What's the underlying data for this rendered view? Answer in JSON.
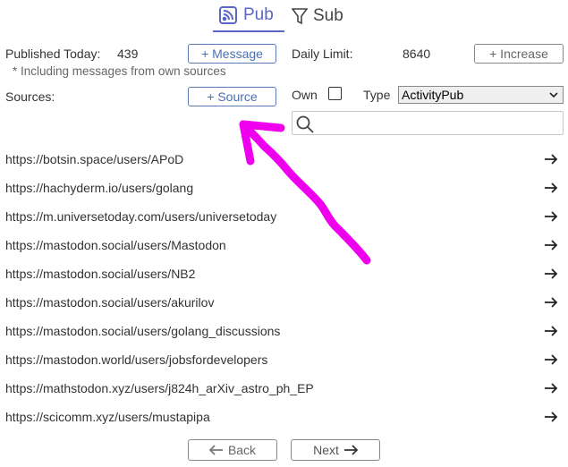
{
  "tabs": [
    {
      "label": "Pub",
      "icon": "rss-icon",
      "active": true
    },
    {
      "label": "Sub",
      "icon": "filter-icon",
      "active": false
    }
  ],
  "stats": {
    "published_label": "Published Today:",
    "published_value": "439",
    "message_button": "+ Message",
    "limit_label": "Daily Limit:",
    "limit_value": "8640",
    "increase_button": "+ Increase",
    "note": "* Including messages from own sources"
  },
  "sources": {
    "label": "Sources:",
    "add_button": "+ Source",
    "own_label": "Own",
    "own_checked": false,
    "type_label": "Type",
    "type_value": "ActivityPub",
    "search_value": ""
  },
  "items": [
    {
      "url": "https://botsin.space/users/APoD"
    },
    {
      "url": "https://hachyderm.io/users/golang"
    },
    {
      "url": "https://m.universetoday.com/users/universetoday"
    },
    {
      "url": "https://mastodon.social/users/Mastodon"
    },
    {
      "url": "https://mastodon.social/users/NB2"
    },
    {
      "url": "https://mastodon.social/users/akurilov"
    },
    {
      "url": "https://mastodon.social/users/golang_discussions"
    },
    {
      "url": "https://mastodon.world/users/jobsfordevelopers"
    },
    {
      "url": "https://mathstodon.xyz/users/j824h_arXiv_astro_ph_EP"
    },
    {
      "url": "https://scicomm.xyz/users/mustapipa"
    }
  ],
  "pager": {
    "back": "Back",
    "next": "Next"
  },
  "colors": {
    "accent": "#5a67c4",
    "annotation": "#ee00ee"
  }
}
